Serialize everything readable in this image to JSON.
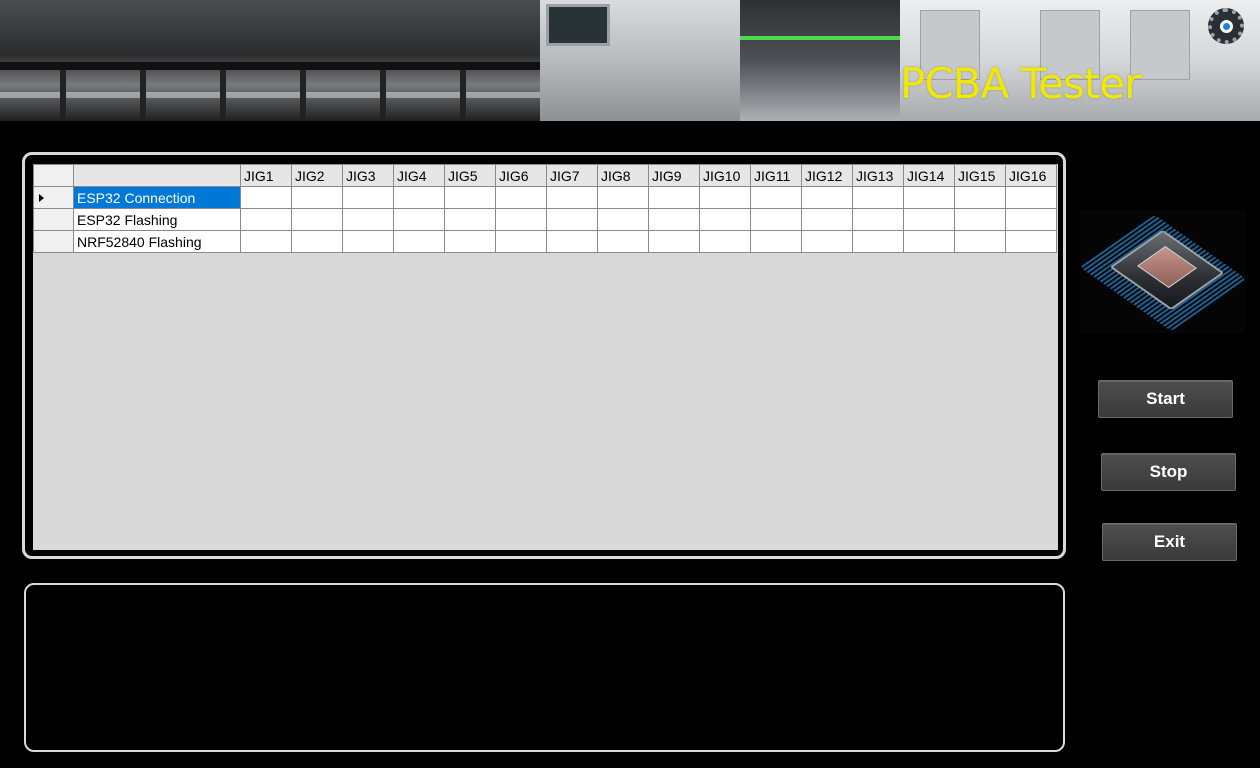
{
  "header": {
    "title": "PCBA Tester",
    "settings_icon": "gear-icon"
  },
  "grid": {
    "columns": [
      "JIG1",
      "JIG2",
      "JIG3",
      "JIG4",
      "JIG5",
      "JIG6",
      "JIG7",
      "JIG8",
      "JIG9",
      "JIG10",
      "JIG11",
      "JIG12",
      "JIG13",
      "JIG14",
      "JIG15",
      "JIG16"
    ],
    "rows": [
      {
        "task": "ESP32 Connection",
        "selected": true,
        "cells": [
          "",
          "",
          "",
          "",
          "",
          "",
          "",
          "",
          "",
          "",
          "",
          "",
          "",
          "",
          "",
          ""
        ]
      },
      {
        "task": "ESP32 Flashing",
        "selected": false,
        "cells": [
          "",
          "",
          "",
          "",
          "",
          "",
          "",
          "",
          "",
          "",
          "",
          "",
          "",
          "",
          "",
          ""
        ]
      },
      {
        "task": "NRF52840 Flashing",
        "selected": false,
        "cells": [
          "",
          "",
          "",
          "",
          "",
          "",
          "",
          "",
          "",
          "",
          "",
          "",
          "",
          "",
          "",
          ""
        ]
      }
    ],
    "selection_color": "#0078d7"
  },
  "log": {
    "text": ""
  },
  "buttons": {
    "start": "Start",
    "stop": "Stop",
    "exit": "Exit"
  },
  "colors": {
    "title": "#f2e900",
    "background": "#000000",
    "grid_background": "#d9d9d9"
  }
}
